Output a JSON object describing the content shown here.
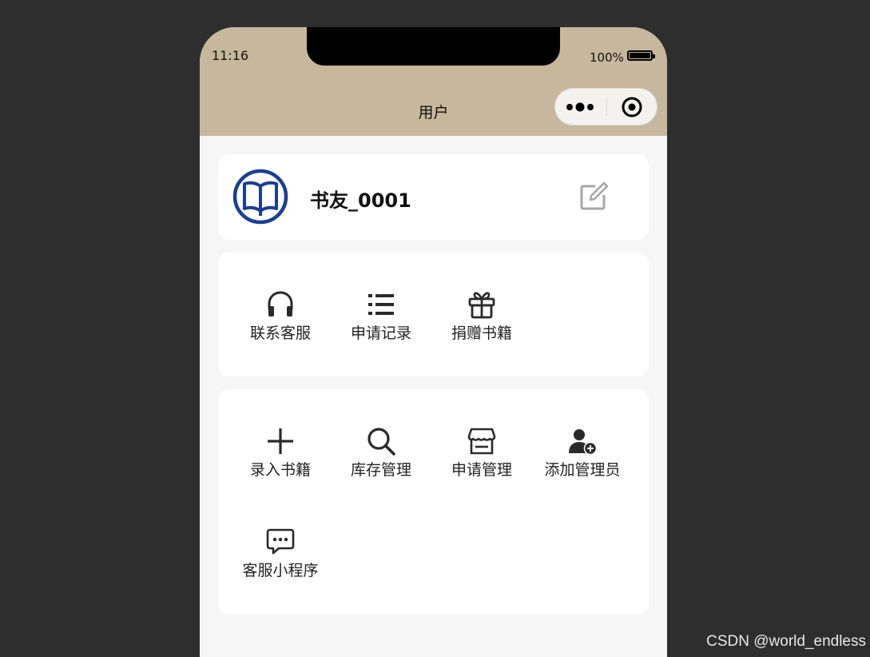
{
  "status_bar": {
    "time": "11:16",
    "battery": "100%"
  },
  "nav": {
    "title": "用户"
  },
  "profile": {
    "username": "书友_0001"
  },
  "menu_group_1": {
    "items": [
      {
        "label": "联系客服",
        "icon": "headset-icon"
      },
      {
        "label": "申请记录",
        "icon": "list-icon"
      },
      {
        "label": "捐赠书籍",
        "icon": "gift-icon"
      }
    ]
  },
  "menu_group_2": {
    "items": [
      {
        "label": "录入书籍",
        "icon": "plus-icon"
      },
      {
        "label": "库存管理",
        "icon": "search-icon"
      },
      {
        "label": "申请管理",
        "icon": "store-icon"
      },
      {
        "label": "添加管理员",
        "icon": "add-user-icon"
      },
      {
        "label": "客服小程序",
        "icon": "chat-icon"
      }
    ]
  },
  "watermark": "CSDN @world_endless",
  "colors": {
    "header": "#c6b79d",
    "avatar": "#1a3f8f",
    "page_bg": "#2e2e2e"
  }
}
